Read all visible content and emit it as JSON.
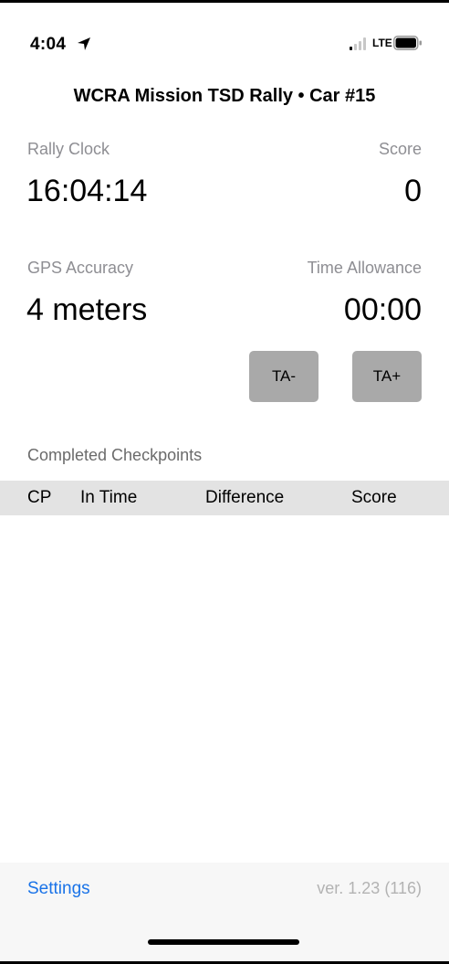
{
  "status_bar": {
    "time": "4:04",
    "location_icon": "location-arrow-icon",
    "network": "LTE",
    "signal_icon": "cellular-signal-icon",
    "battery_icon": "battery-icon"
  },
  "title": "WCRA Mission TSD Rally  •  Car #15",
  "rally_clock": {
    "label": "Rally Clock",
    "value": "16:04:14"
  },
  "score": {
    "label": "Score",
    "value": "0"
  },
  "gps_accuracy": {
    "label": "GPS Accuracy",
    "value": "4 meters"
  },
  "time_allowance": {
    "label": "Time Allowance",
    "value": "00:00"
  },
  "buttons": {
    "ta_minus": "TA-",
    "ta_plus": "TA+"
  },
  "checkpoints": {
    "section_label": "Completed Checkpoints",
    "columns": [
      "CP",
      "In Time",
      "Difference",
      "Score"
    ],
    "rows": []
  },
  "footer": {
    "settings_label": "Settings",
    "version": "ver. 1.23 (116)"
  },
  "colors": {
    "accent": "#1a73e8",
    "button_bg": "#a9a9a9",
    "header_bg": "#e3e3e3",
    "muted_text": "#8e8e93"
  }
}
